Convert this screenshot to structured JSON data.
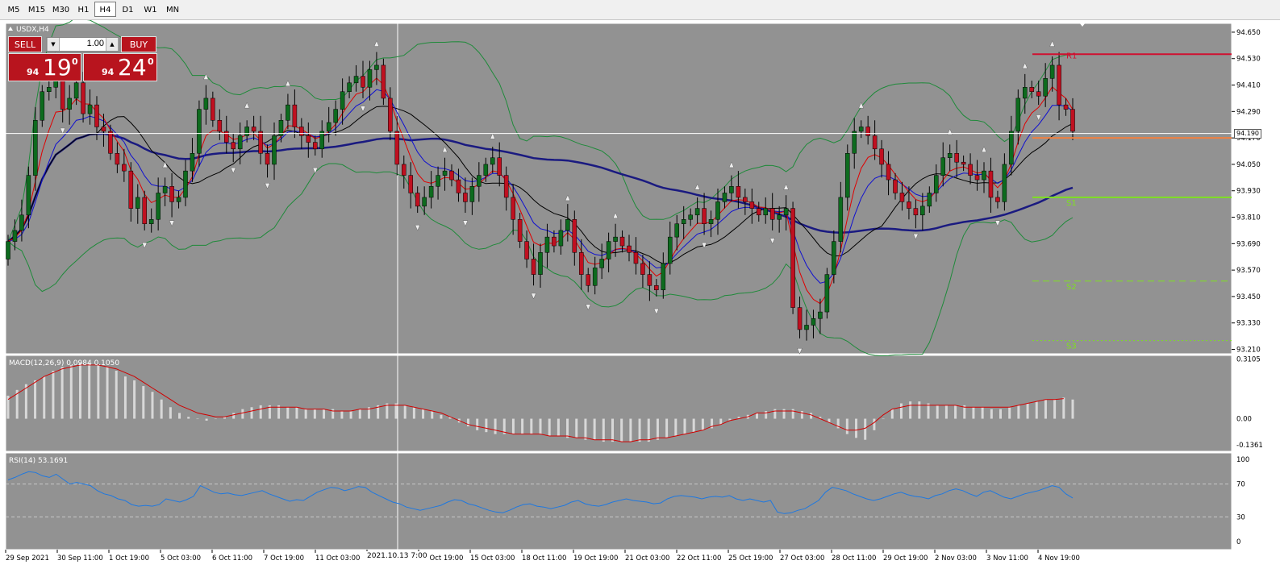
{
  "timeframes": [
    "M5",
    "M15",
    "M30",
    "H1",
    "H4",
    "D1",
    "W1",
    "MN"
  ],
  "active_timeframe": "H4",
  "symbol_label": "USDX,H4",
  "trade_panel": {
    "sell_label": "SELL",
    "buy_label": "BUY",
    "lot_value": "1.00",
    "sell_price": {
      "prefix": "94",
      "big": "19",
      "sup": "0"
    },
    "buy_price": {
      "prefix": "94",
      "big": "24",
      "sup": "0"
    }
  },
  "crosshair_date": "2021.10.13 7:00",
  "current_price_label": "94.190",
  "colors": {
    "chart_bg": "#929292",
    "bull_candle": "#0d6b1e",
    "bear_candle": "#c01020",
    "ema_fast": "#e00000",
    "ema_mid": "#1010d0",
    "sma_slow": "#000000",
    "ma_long": "#1a1a80",
    "bollinger": "#1f8a3a",
    "macd_hist": "#d8d8d8",
    "macd_signal": "#d00000",
    "rsi_line": "#1e78e0",
    "r1": "#d01030",
    "s_levels": "#7ee020",
    "pivot": "#f08040"
  },
  "chart_data": {
    "type": "candlestick",
    "title": "USDX,H4",
    "price_axis_ticks": [
      "94.650",
      "94.530",
      "94.410",
      "94.290",
      "94.170",
      "94.050",
      "93.930",
      "93.810",
      "93.690",
      "93.570",
      "93.450",
      "93.330",
      "93.210"
    ],
    "ylim": [
      93.19,
      94.69
    ],
    "time_axis_labels": [
      "29 Sep 2021",
      "30 Sep 11:00",
      "1 Oct 19:00",
      "5 Oct 03:00",
      "6 Oct 11:00",
      "7 Oct 19:00",
      "11 Oct 03:00",
      "12 Oct 11:00",
      "13 Oct 19:00",
      "15 Oct 03:00",
      "18 Oct 11:00",
      "19 Oct 19:00",
      "21 Oct 03:00",
      "22 Oct 11:00",
      "25 Oct 19:00",
      "27 Oct 03:00",
      "28 Oct 11:00",
      "29 Oct 19:00",
      "2 Nov 03:00",
      "3 Nov 11:00",
      "4 Nov 19:00"
    ],
    "close_series": [
      93.7,
      93.75,
      93.82,
      94.0,
      94.25,
      94.38,
      94.4,
      94.45,
      94.3,
      94.35,
      94.42,
      94.28,
      94.32,
      94.22,
      94.2,
      94.1,
      94.05,
      94.02,
      93.85,
      93.9,
      93.78,
      93.8,
      93.92,
      93.95,
      93.88,
      93.9,
      94.02,
      94.1,
      94.3,
      94.35,
      94.25,
      94.2,
      94.15,
      94.12,
      94.18,
      94.22,
      94.2,
      94.1,
      94.05,
      94.18,
      94.25,
      94.32,
      94.22,
      94.18,
      94.15,
      94.12,
      94.2,
      94.24,
      94.3,
      94.38,
      94.42,
      94.45,
      94.4,
      94.48,
      94.5,
      94.35,
      94.2,
      94.05,
      94.0,
      93.92,
      93.86,
      93.9,
      93.95,
      94.0,
      94.02,
      93.98,
      93.92,
      93.88,
      93.95,
      94.0,
      94.05,
      94.08,
      94.0,
      93.9,
      93.8,
      93.7,
      93.62,
      93.55,
      93.65,
      93.72,
      93.68,
      93.75,
      93.8,
      93.65,
      93.55,
      93.5,
      93.58,
      93.62,
      93.7,
      93.72,
      93.68,
      93.65,
      93.6,
      93.55,
      93.5,
      93.48,
      93.6,
      93.72,
      93.78,
      93.8,
      93.82,
      93.85,
      93.78,
      93.8,
      93.88,
      93.92,
      93.95,
      93.9,
      93.88,
      93.85,
      93.82,
      93.85,
      93.8,
      93.82,
      93.85,
      93.4,
      93.3,
      93.32,
      93.35,
      93.38,
      93.55,
      93.7,
      93.9,
      94.1,
      94.2,
      94.22,
      94.18,
      94.12,
      94.05,
      93.98,
      93.92,
      93.88,
      93.85,
      93.82,
      93.86,
      93.92,
      94.0,
      94.08,
      94.1,
      94.06,
      94.05,
      94.0,
      93.98,
      94.02,
      93.9,
      93.88,
      94.05,
      94.2,
      94.35,
      94.4,
      94.38,
      94.36,
      94.44,
      94.5,
      94.32,
      94.3,
      94.2
    ],
    "open_series": [
      93.62,
      93.7,
      93.75,
      93.82,
      94.0,
      94.25,
      94.38,
      94.4,
      94.45,
      94.3,
      94.35,
      94.42,
      94.28,
      94.32,
      94.22,
      94.2,
      94.1,
      94.05,
      94.02,
      93.85,
      93.9,
      93.78,
      93.8,
      93.92,
      93.95,
      93.88,
      93.9,
      94.02,
      94.1,
      94.3,
      94.35,
      94.25,
      94.2,
      94.15,
      94.12,
      94.18,
      94.22,
      94.2,
      94.1,
      94.05,
      94.18,
      94.25,
      94.32,
      94.22,
      94.18,
      94.15,
      94.12,
      94.2,
      94.24,
      94.3,
      94.38,
      94.42,
      94.45,
      94.4,
      94.48,
      94.5,
      94.35,
      94.2,
      94.05,
      94.0,
      93.92,
      93.86,
      93.9,
      93.95,
      94.0,
      94.02,
      93.98,
      93.92,
      93.88,
      93.95,
      94.0,
      94.05,
      94.08,
      94.0,
      93.9,
      93.8,
      93.7,
      93.62,
      93.55,
      93.65,
      93.72,
      93.68,
      93.75,
      93.8,
      93.65,
      93.55,
      93.5,
      93.58,
      93.62,
      93.7,
      93.72,
      93.68,
      93.65,
      93.6,
      93.55,
      93.5,
      93.48,
      93.6,
      93.72,
      93.78,
      93.8,
      93.82,
      93.85,
      93.78,
      93.8,
      93.88,
      93.92,
      93.95,
      93.9,
      93.88,
      93.85,
      93.82,
      93.85,
      93.8,
      93.82,
      93.85,
      93.4,
      93.3,
      93.32,
      93.35,
      93.38,
      93.55,
      93.7,
      93.9,
      94.1,
      94.2,
      94.22,
      94.18,
      94.12,
      94.05,
      93.98,
      93.92,
      93.88,
      93.85,
      93.82,
      93.86,
      93.92,
      94.0,
      94.08,
      94.1,
      94.06,
      94.05,
      94.0,
      93.98,
      94.02,
      93.9,
      93.88,
      94.05,
      94.2,
      94.35,
      94.4,
      94.38,
      94.36,
      94.44,
      94.5,
      94.32,
      94.3
    ],
    "levels": [
      {
        "name": "R1",
        "value": 94.55,
        "style": "solid"
      },
      {
        "name": "S1",
        "value": 93.9,
        "style": "solid"
      },
      {
        "name": "S2",
        "value": 93.52,
        "style": "dashed"
      },
      {
        "name": "S3",
        "value": 93.25,
        "style": "dotted"
      }
    ],
    "current_price": 94.19,
    "pivot_price": 94.17,
    "macd": {
      "label": "MACD(12,26,9) 0.0984 0.1050",
      "ticks": [
        "0.3105",
        "0.00",
        "-0.1361"
      ],
      "ylim": [
        -0.17,
        0.33
      ],
      "histogram": [
        0.12,
        0.15,
        0.18,
        0.2,
        0.22,
        0.25,
        0.27,
        0.28,
        0.29,
        0.29,
        0.28,
        0.27,
        0.25,
        0.22,
        0.2,
        0.17,
        0.14,
        0.1,
        0.06,
        0.03,
        0.01,
        0.0,
        -0.01,
        0.0,
        0.01,
        0.03,
        0.05,
        0.06,
        0.07,
        0.07,
        0.07,
        0.06,
        0.06,
        0.05,
        0.05,
        0.05,
        0.05,
        0.04,
        0.04,
        0.05,
        0.06,
        0.07,
        0.08,
        0.08,
        0.07,
        0.06,
        0.05,
        0.04,
        0.02,
        0.01,
        -0.02,
        -0.04,
        -0.06,
        -0.07,
        -0.08,
        -0.08,
        -0.08,
        -0.08,
        -0.08,
        -0.08,
        -0.09,
        -0.09,
        -0.1,
        -0.1,
        -0.11,
        -0.11,
        -0.12,
        -0.12,
        -0.12,
        -0.12,
        -0.12,
        -0.12,
        -0.11,
        -0.1,
        -0.09,
        -0.08,
        -0.07,
        -0.06,
        -0.05,
        -0.03,
        -0.01,
        0.01,
        0.02,
        0.03,
        0.04,
        0.05,
        0.05,
        0.05,
        0.04,
        0.03,
        0.01,
        -0.02,
        -0.05,
        -0.08,
        -0.1,
        -0.11,
        -0.06,
        0.0,
        0.05,
        0.08,
        0.09,
        0.09,
        0.08,
        0.07,
        0.07,
        0.07,
        0.07,
        0.06,
        0.06,
        0.05,
        0.05,
        0.06,
        0.07,
        0.08,
        0.09,
        0.1,
        0.1,
        0.11,
        0.1
      ],
      "signal": [
        0.1,
        0.13,
        0.16,
        0.19,
        0.22,
        0.24,
        0.26,
        0.27,
        0.28,
        0.28,
        0.28,
        0.27,
        0.26,
        0.24,
        0.22,
        0.19,
        0.16,
        0.13,
        0.1,
        0.07,
        0.05,
        0.03,
        0.02,
        0.01,
        0.01,
        0.02,
        0.03,
        0.04,
        0.05,
        0.06,
        0.06,
        0.06,
        0.06,
        0.05,
        0.05,
        0.05,
        0.04,
        0.04,
        0.04,
        0.05,
        0.05,
        0.06,
        0.07,
        0.07,
        0.07,
        0.06,
        0.05,
        0.04,
        0.03,
        0.01,
        -0.01,
        -0.03,
        -0.04,
        -0.05,
        -0.06,
        -0.07,
        -0.08,
        -0.08,
        -0.08,
        -0.08,
        -0.09,
        -0.09,
        -0.09,
        -0.1,
        -0.1,
        -0.11,
        -0.11,
        -0.11,
        -0.12,
        -0.12,
        -0.11,
        -0.11,
        -0.1,
        -0.1,
        -0.09,
        -0.08,
        -0.07,
        -0.06,
        -0.04,
        -0.03,
        -0.01,
        0.0,
        0.01,
        0.03,
        0.03,
        0.04,
        0.04,
        0.04,
        0.03,
        0.02,
        0.0,
        -0.02,
        -0.04,
        -0.06,
        -0.06,
        -0.05,
        -0.02,
        0.02,
        0.05,
        0.06,
        0.07,
        0.07,
        0.07,
        0.07,
        0.07,
        0.07,
        0.06,
        0.06,
        0.06,
        0.06,
        0.06,
        0.06,
        0.07,
        0.08,
        0.09,
        0.1,
        0.1,
        0.105
      ]
    },
    "rsi": {
      "label": "RSI(14) 53.1691",
      "ticks": [
        "100",
        "70",
        "30",
        "0"
      ],
      "ylim": [
        0,
        100
      ],
      "levels": [
        70,
        30
      ],
      "values": [
        75,
        78,
        82,
        85,
        84,
        80,
        78,
        82,
        76,
        70,
        72,
        70,
        68,
        62,
        58,
        56,
        52,
        50,
        45,
        43,
        44,
        43,
        45,
        52,
        50,
        48,
        51,
        55,
        68,
        64,
        60,
        58,
        59,
        57,
        56,
        58,
        60,
        62,
        58,
        55,
        52,
        49,
        51,
        50,
        55,
        60,
        63,
        66,
        65,
        62,
        64,
        67,
        66,
        60,
        56,
        52,
        48,
        46,
        42,
        40,
        38,
        40,
        42,
        44,
        48,
        51,
        50,
        46,
        44,
        41,
        38,
        36,
        35,
        38,
        42,
        45,
        46,
        43,
        42,
        40,
        42,
        44,
        48,
        50,
        46,
        44,
        43,
        45,
        48,
        50,
        52,
        50,
        49,
        48,
        46,
        47,
        52,
        55,
        56,
        55,
        54,
        52,
        54,
        55,
        54,
        56,
        52,
        50,
        52,
        50,
        48,
        50,
        36,
        34,
        35,
        38,
        40,
        45,
        50,
        60,
        66,
        64,
        62,
        58,
        55,
        52,
        50,
        52,
        55,
        58,
        60,
        57,
        55,
        54,
        52,
        56,
        58,
        62,
        64,
        62,
        58,
        55,
        60,
        62,
        58,
        54,
        52,
        55,
        58,
        60,
        62,
        65,
        68,
        66,
        58,
        53
      ]
    }
  }
}
